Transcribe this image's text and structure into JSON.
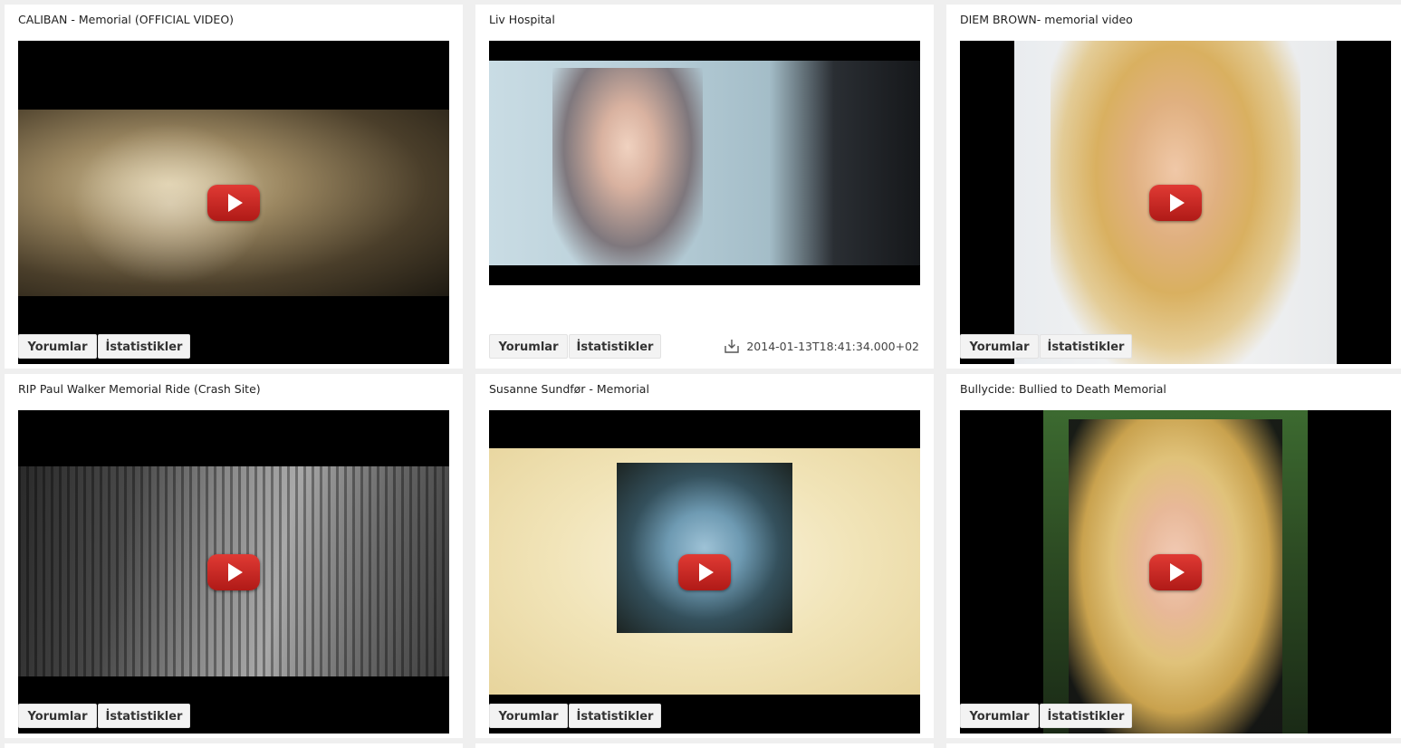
{
  "labels": {
    "comments": "Yorumlar",
    "stats": "İstatistikler"
  },
  "colors": {
    "play_button": "#cc2420",
    "background": "#efefef",
    "card": "#ffffff"
  },
  "cards": [
    {
      "title": "CALIBAN - Memorial (OFFICIAL VIDEO)",
      "date": ""
    },
    {
      "title": "Liv Hospital",
      "date": "2014-01-13T18:41:34.000+02"
    },
    {
      "title": "DIEM BROWN- memorial video",
      "date": ""
    },
    {
      "title": "RIP Paul Walker Memorial Ride (Crash Site)",
      "date": ""
    },
    {
      "title": "Susanne Sundfør - Memorial",
      "date": ""
    },
    {
      "title": "Bullycide: Bullied to Death Memorial",
      "date": ""
    }
  ],
  "icons": {
    "play": "youtube-play-icon",
    "download": "download-icon"
  }
}
